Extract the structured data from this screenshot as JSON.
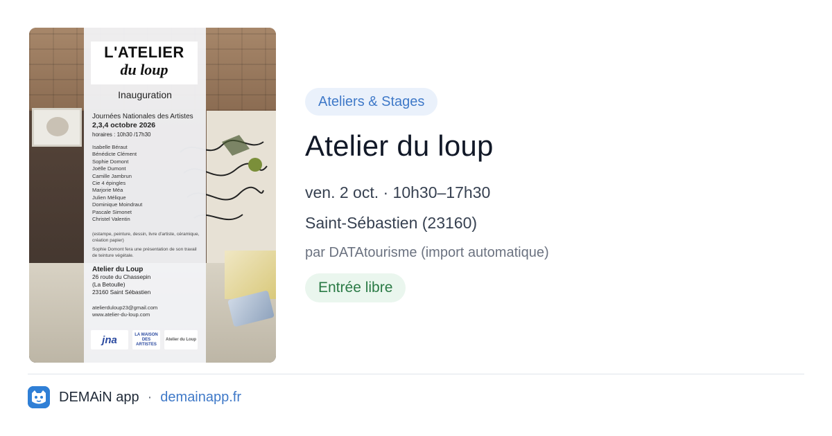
{
  "poster": {
    "title_line1": "L'ATELIER",
    "title_line2": "du loup",
    "subtitle": "Inauguration",
    "event_name": "Journées Nationales des Artistes",
    "event_dates": "2,3,4 octobre 2026",
    "event_hours": "horaires : 10h30 /17h30",
    "artists": [
      "Isabelle Béraut",
      "Bénédicte Clément",
      "Sophie Domont",
      "Joëlle Dumont",
      "Camille Jambrun",
      "Cie 4 épingles",
      "Marjorie Méa",
      "Julien Mélique",
      "Dominique Moindraut",
      "Pascale Simonet",
      "Christel Valentin"
    ],
    "note1": "(estampe, peinture, dessin, livre d'artiste, céramique, création papier)",
    "note2": "Sophie Domont fera une présentation de son travail de teinture végétale.",
    "venue_name": "Atelier du Loup",
    "address_line1": "26 route du Chassepin",
    "address_line2": "(La Betoulle)",
    "address_line3": "23160 Saint Sébastien",
    "email": "atelierduloup23@gmail.com",
    "website": "www.atelier-du-loup.com",
    "logo1": "jna",
    "logo2": "LA MAISON DES ARTISTES",
    "logo3": "Atelier du Loup"
  },
  "event": {
    "category": "Ateliers & Stages",
    "title": "Atelier du loup",
    "datetime": "ven. 2 oct. · 10h30–17h30",
    "location": "Saint-Sébastien (23160)",
    "source": "par DATAtourisme (import automatique)",
    "price": "Entrée libre"
  },
  "footer": {
    "app_icon": "demain-app-icon",
    "app_name": "DEMAiN app",
    "separator": "·",
    "domain": "demainapp.fr"
  },
  "colors": {
    "accent_blue": "#3f79c8",
    "tag_bg": "#eaf1fb",
    "price_green": "#2a7a45",
    "price_bg": "#eaf6ee"
  }
}
